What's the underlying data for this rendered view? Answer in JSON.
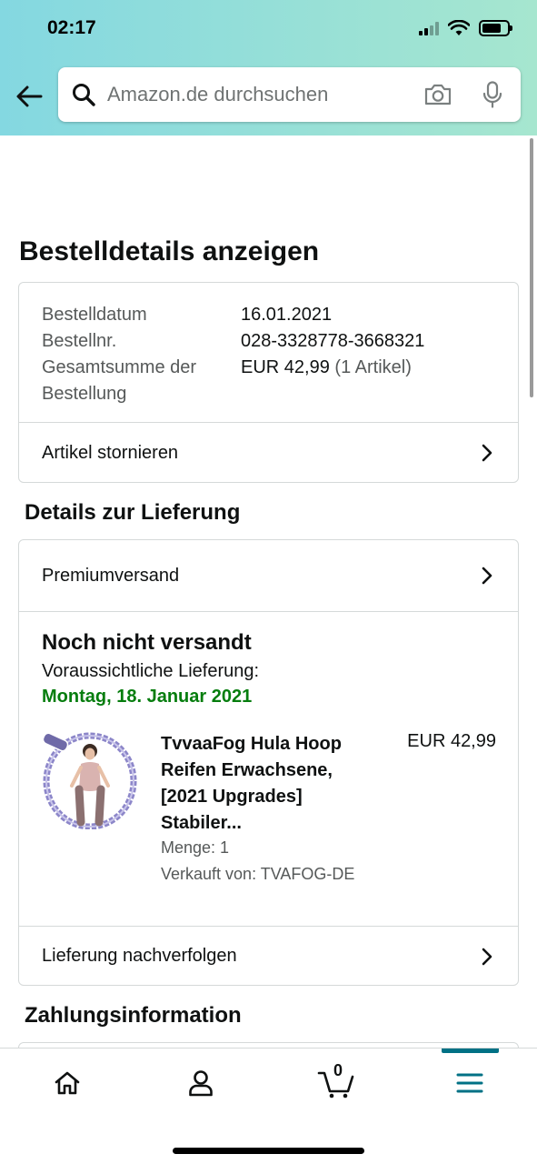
{
  "status_bar": {
    "time": "02:17"
  },
  "search": {
    "placeholder": "Amazon.de durchsuchen"
  },
  "page": {
    "title": "Bestelldetails anzeigen"
  },
  "order": {
    "rows": [
      {
        "label": "Bestelldatum",
        "value": "16.01.2021"
      },
      {
        "label": "Bestellnr.",
        "value": "028-3328778-3668321"
      },
      {
        "label": "Gesamtsumme der Bestellung",
        "value": "EUR 42,99",
        "extra": "(1 Artikel)"
      }
    ],
    "cancel_label": "Artikel stornieren"
  },
  "delivery": {
    "section_title": "Details zur Lieferung",
    "shipping_method": "Premiumversand",
    "status": "Noch nicht versandt",
    "expected_label": "Voraussichtliche Lieferung:",
    "expected_date": "Montag, 18. Januar 2021",
    "product": {
      "title": "TvvaaFog Hula Hoop Reifen Erwachsene, [2021 Upgrades] Stabiler...",
      "price": "EUR 42,99",
      "quantity": "Menge: 1",
      "seller": "Verkauft von: TVAFOG-DE"
    },
    "track_label": "Lieferung nachverfolgen"
  },
  "payment": {
    "section_title": "Zahlungsinformation"
  },
  "tabbar": {
    "cart_count": "0"
  },
  "colors": {
    "accent": "#007185",
    "delivery_green": "#067d0e",
    "header_start": "#84d8e1",
    "header_end": "#a6e6cf"
  },
  "icons": [
    "back-arrow-icon",
    "search-icon",
    "camera-icon",
    "microphone-icon",
    "chevron-right-icon",
    "home-icon",
    "account-icon",
    "cart-icon",
    "menu-icon"
  ]
}
